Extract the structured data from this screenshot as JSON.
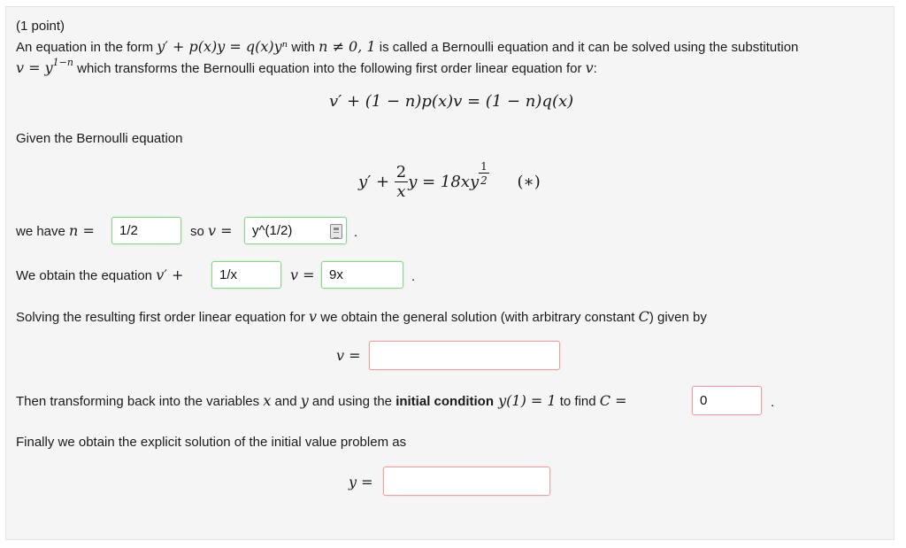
{
  "points_label": "(1 point)",
  "intro": {
    "part1": "An equation in the form ",
    "form": "y′ + p(x)y = q(x)yⁿ",
    "part2": " with ",
    "condition": "n ≠ 0, 1",
    "part3": " is called a Bernoulli equation and it can be solved using the substitution",
    "subst": "v = y",
    "subst_exp": "1−n",
    "part4": " which transforms the Bernoulli equation into the following first order linear equation for ",
    "var_v": "v",
    "colon": ":"
  },
  "linear_equation": "v′ + (1 − n)p(x)v = (1 − n)q(x)",
  "given_label": "Given the Bernoulli equation",
  "bernoulli": {
    "lhs": "y′ + ",
    "frac_num": "2",
    "frac_den": "x",
    "mid": "y = 18xy",
    "exp_num": "1",
    "exp_den": "2",
    "tag": "(∗)"
  },
  "step_n": {
    "prefix": "we have ",
    "n_eq": "n =",
    "n_value": "1/2",
    "so": "so ",
    "v_eq": "v =",
    "v_value": "y^(1/2)",
    "period": "."
  },
  "step_eq": {
    "prefix": "We obtain the equation ",
    "vprime": "v′ +",
    "coef_value": "1/x",
    "v_eq": "v =",
    "rhs_value": "9x",
    "period": "."
  },
  "solving": {
    "text1": "Solving the resulting first order linear equation for ",
    "v": "v",
    "text2": " we obtain the general solution (with arbitrary constant ",
    "C": "C",
    "text3": ") given by"
  },
  "general_solution": {
    "label": "v =",
    "value": ""
  },
  "transform": {
    "text1": "Then transforming back into the variables ",
    "x": "x",
    "and": " and ",
    "y": "y",
    "text2": " and using the ",
    "bold": "initial condition",
    "ic": " y(1) = 1",
    "text3": " to find ",
    "C_eq": "C =",
    "C_value": "0",
    "period": "."
  },
  "finally_label": "Finally we obtain the explicit solution of the initial value problem as",
  "explicit_solution": {
    "label": "y =",
    "value": ""
  },
  "colors": {
    "correct_border": "#8fd18f",
    "incorrect_border": "#e6a3a3",
    "panel_bg": "#f5f5f5"
  }
}
